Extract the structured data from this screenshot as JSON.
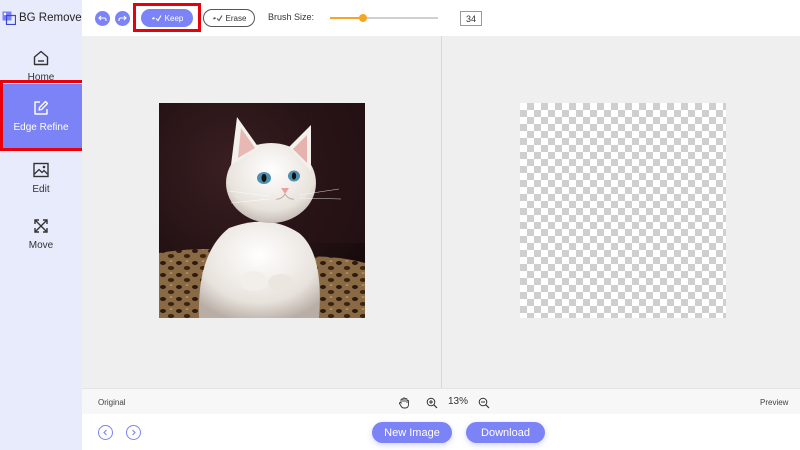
{
  "app": {
    "title": "BG Remover"
  },
  "sidebar": {
    "items": [
      {
        "label": "Home",
        "icon": "home-icon"
      },
      {
        "label": "Edge Refine",
        "icon": "edit-square-icon"
      },
      {
        "label": "Edit",
        "icon": "image-edit-icon"
      },
      {
        "label": "Move",
        "icon": "move-arrows-icon"
      }
    ]
  },
  "toolbar": {
    "keep_label": "Keep",
    "erase_label": "Erase",
    "brush_size_label": "Brush Size:",
    "brush_size_value": "34",
    "brush_size_fraction": 0.31
  },
  "canvas": {
    "original_label": "Original",
    "preview_label": "Preview",
    "zoom": "13%"
  },
  "bottom": {
    "new_image_label": "New Image",
    "download_label": "Download"
  },
  "colors": {
    "accent": "#7b83f6",
    "sidebar_bg": "#e8ebfb",
    "highlight": "#e8000b",
    "slider": "#f5a623"
  }
}
